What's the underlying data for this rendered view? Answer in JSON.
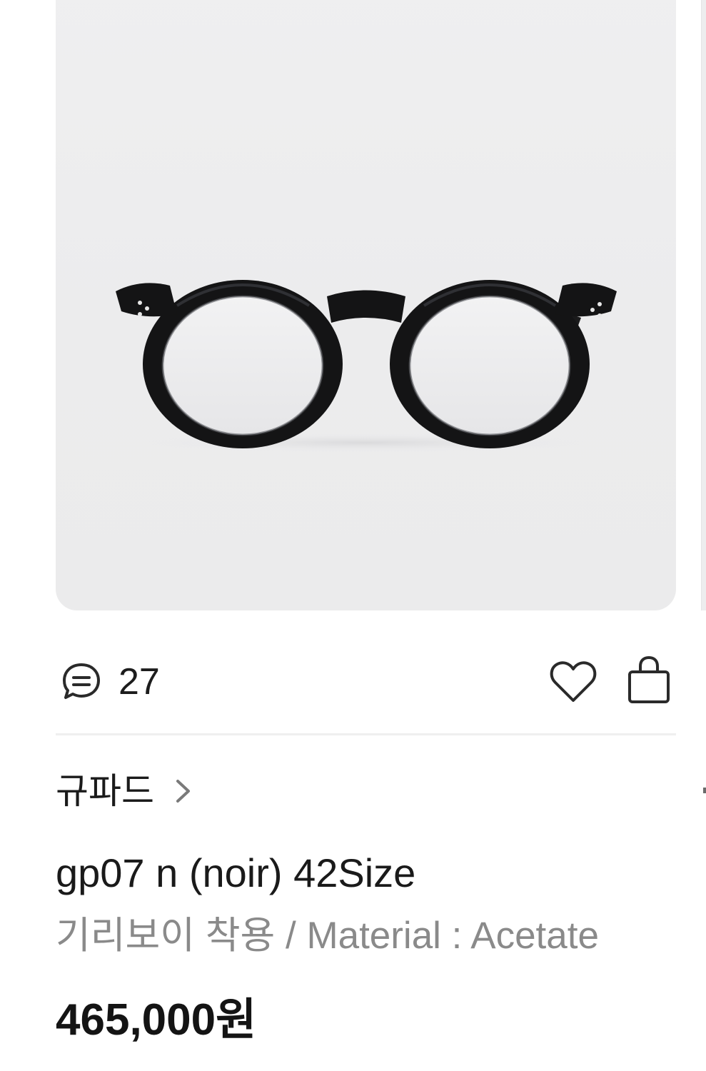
{
  "product": {
    "image_alt": "gp07 n (noir) glasses",
    "comment_count": "27",
    "brand": "규파드",
    "name": "gp07 n (noir) 42Size",
    "description": "기리보이 착용 / Material : Acetate",
    "price": "465,000원"
  },
  "icons": {
    "comment": "comment-icon",
    "heart": "heart-icon",
    "bag": "shopping-bag-icon",
    "chevron": "chevron-right-icon"
  },
  "colors": {
    "image_background": "#ececed",
    "text_primary": "#1a1a1a",
    "text_secondary": "#8a8a8a",
    "divider": "#efefef"
  }
}
